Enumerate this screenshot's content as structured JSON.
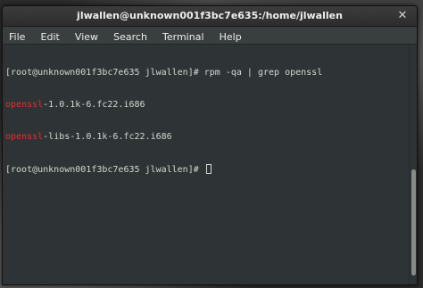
{
  "window": {
    "title": "jlwallen@unknown001f3bc7e635:/home/jlwallen",
    "close_glyph": "✕"
  },
  "menubar": {
    "items": [
      "File",
      "Edit",
      "View",
      "Search",
      "Terminal",
      "Help"
    ]
  },
  "terminal": {
    "lines": [
      {
        "prompt": "[root@unknown001f3bc7e635 jlwallen]# ",
        "command": "rpm -qa | grep openssl"
      },
      {
        "match": "openssl",
        "rest": "-1.0.1k-6.fc22.i686"
      },
      {
        "match": "openssl",
        "rest": "-libs-1.0.1k-6.fc22.i686"
      },
      {
        "prompt": "[root@unknown001f3bc7e635 jlwallen]# ",
        "command": ""
      }
    ],
    "highlight_color": "#ef2929",
    "foreground_color": "#d3d7cf",
    "background_color": "#2e3436"
  }
}
